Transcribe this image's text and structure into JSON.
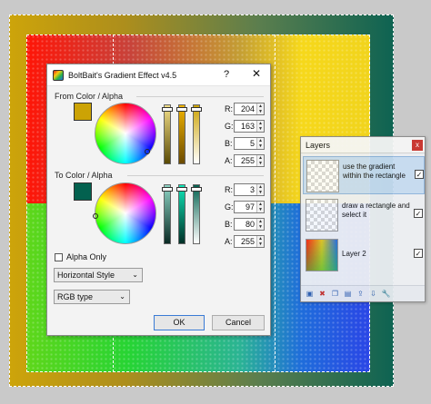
{
  "dialog": {
    "title": "BoltBait's Gradient Effect v4.5",
    "help_label": "?",
    "close_label": "✕",
    "from_group_label": "From Color / Alpha",
    "to_group_label": "To Color / Alpha",
    "from_color": "#cca305",
    "to_color": "#03614f",
    "from_fields": [
      {
        "label": "R:",
        "value": "204"
      },
      {
        "label": "G:",
        "value": "163"
      },
      {
        "label": "B:",
        "value": "5"
      },
      {
        "label": "A:",
        "value": "255"
      }
    ],
    "to_fields": [
      {
        "label": "R:",
        "value": "3"
      },
      {
        "label": "G:",
        "value": "97"
      },
      {
        "label": "B:",
        "value": "80"
      },
      {
        "label": "A:",
        "value": "255"
      }
    ],
    "alpha_only_label": "Alpha Only",
    "style_select": "Horizontal Style",
    "type_select": "RGB type",
    "ok_label": "OK",
    "cancel_label": "Cancel"
  },
  "layers": {
    "title": "Layers",
    "close_label": "x",
    "items": [
      {
        "name": "use the gradient within the rectangle",
        "checked": "✓",
        "selected": true
      },
      {
        "name": "draw a rectangle and select it",
        "checked": "✓",
        "selected": false
      },
      {
        "name": "Layer 2",
        "checked": "✓",
        "selected": false
      }
    ],
    "toolbar_icons": [
      "add-layer-icon",
      "delete-layer-icon",
      "duplicate-layer-icon",
      "merge-layer-icon",
      "import-icon",
      "move-down-icon",
      "properties-icon"
    ]
  }
}
